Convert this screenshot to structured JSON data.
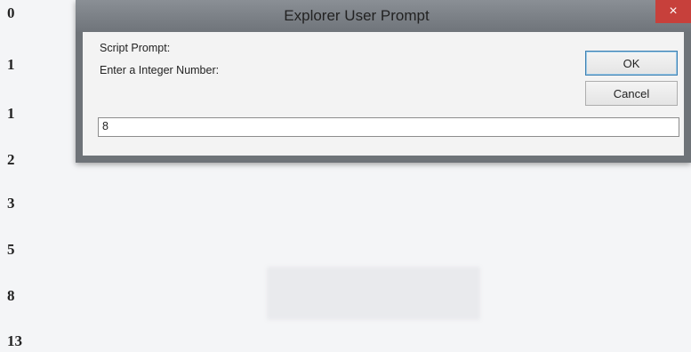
{
  "sequence": [
    "0",
    "1",
    "1",
    "2",
    "3",
    "5",
    "8",
    "13"
  ],
  "dialog": {
    "title": "Explorer User Prompt",
    "close_glyph": "×",
    "script_prompt_label": "Script Prompt:",
    "message": "Enter a Integer Number:",
    "ok_label": "OK",
    "cancel_label": "Cancel",
    "input_value": "8"
  },
  "colors": {
    "titlebar": "#7a7f85",
    "close_button": "#c7403b",
    "client_bg": "#f3f3f3"
  }
}
